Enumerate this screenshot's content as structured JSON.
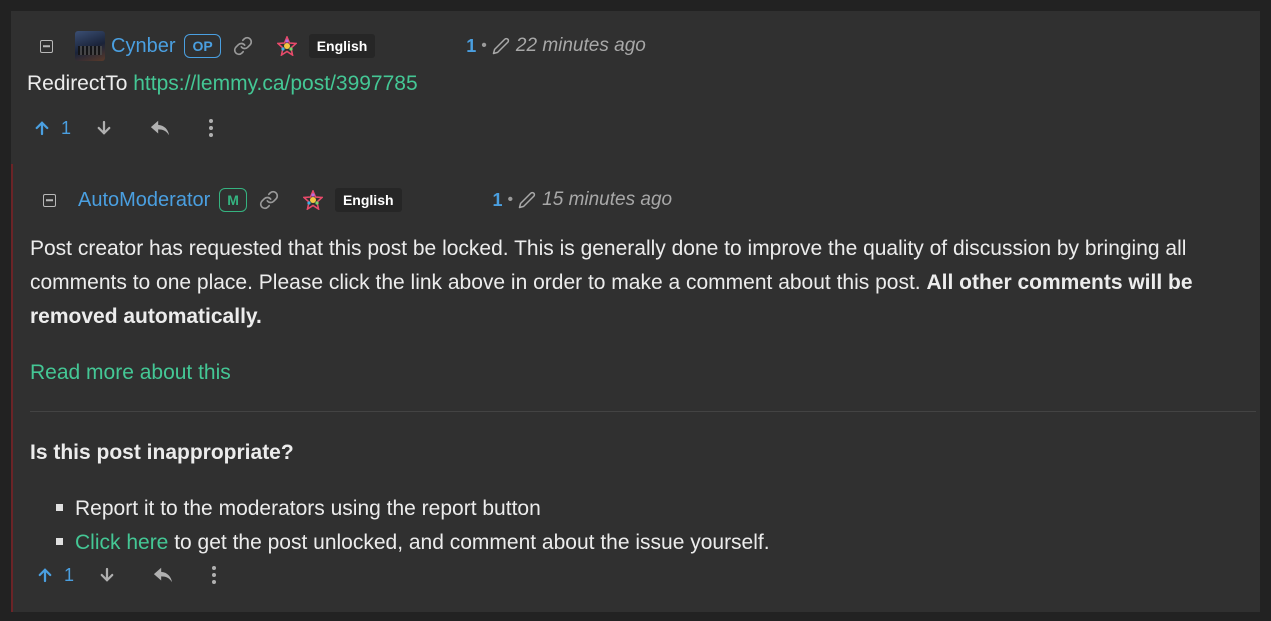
{
  "comments": [
    {
      "username": "Cynber",
      "badge": "OP",
      "language": "English",
      "score": "1",
      "bullet": "•",
      "time": "22 minutes ago",
      "body_prefix": "RedirectTo ",
      "body_link": "https://lemmy.ca/post/3997785",
      "upvotes": "1"
    },
    {
      "username": "AutoModerator",
      "badge": "M",
      "language": "English",
      "score": "1",
      "bullet": "•",
      "time": "15 minutes ago",
      "para1_text": "Post creator has requested that this post be locked. This is generally done to improve the quality of discussion by bringing all comments to one place. Please click the link above in order to make a comment about this post. ",
      "para1_bold": "All other comments will be removed automatically.",
      "read_more": "Read more about this",
      "heading": "Is this post inappropriate?",
      "bullet1": "Report it to the moderators using the report button",
      "bullet2_link": "Click here",
      "bullet2_rest": " to get the post unlocked, and comment about the issue yourself.",
      "upvotes": "1"
    }
  ],
  "icons": {
    "collapse": "minus-square-icon",
    "permalink": "link-icon",
    "instance": "lemmy-logo-icon",
    "edited": "pencil-icon",
    "upvote": "arrow-up-icon",
    "downvote": "arrow-down-icon",
    "reply": "reply-icon",
    "more": "more-vertical-icon"
  },
  "colors": {
    "background": "#303030",
    "accent_blue": "#4a9fe0",
    "link_green": "#44c795",
    "mod_border": "#6b2427"
  }
}
